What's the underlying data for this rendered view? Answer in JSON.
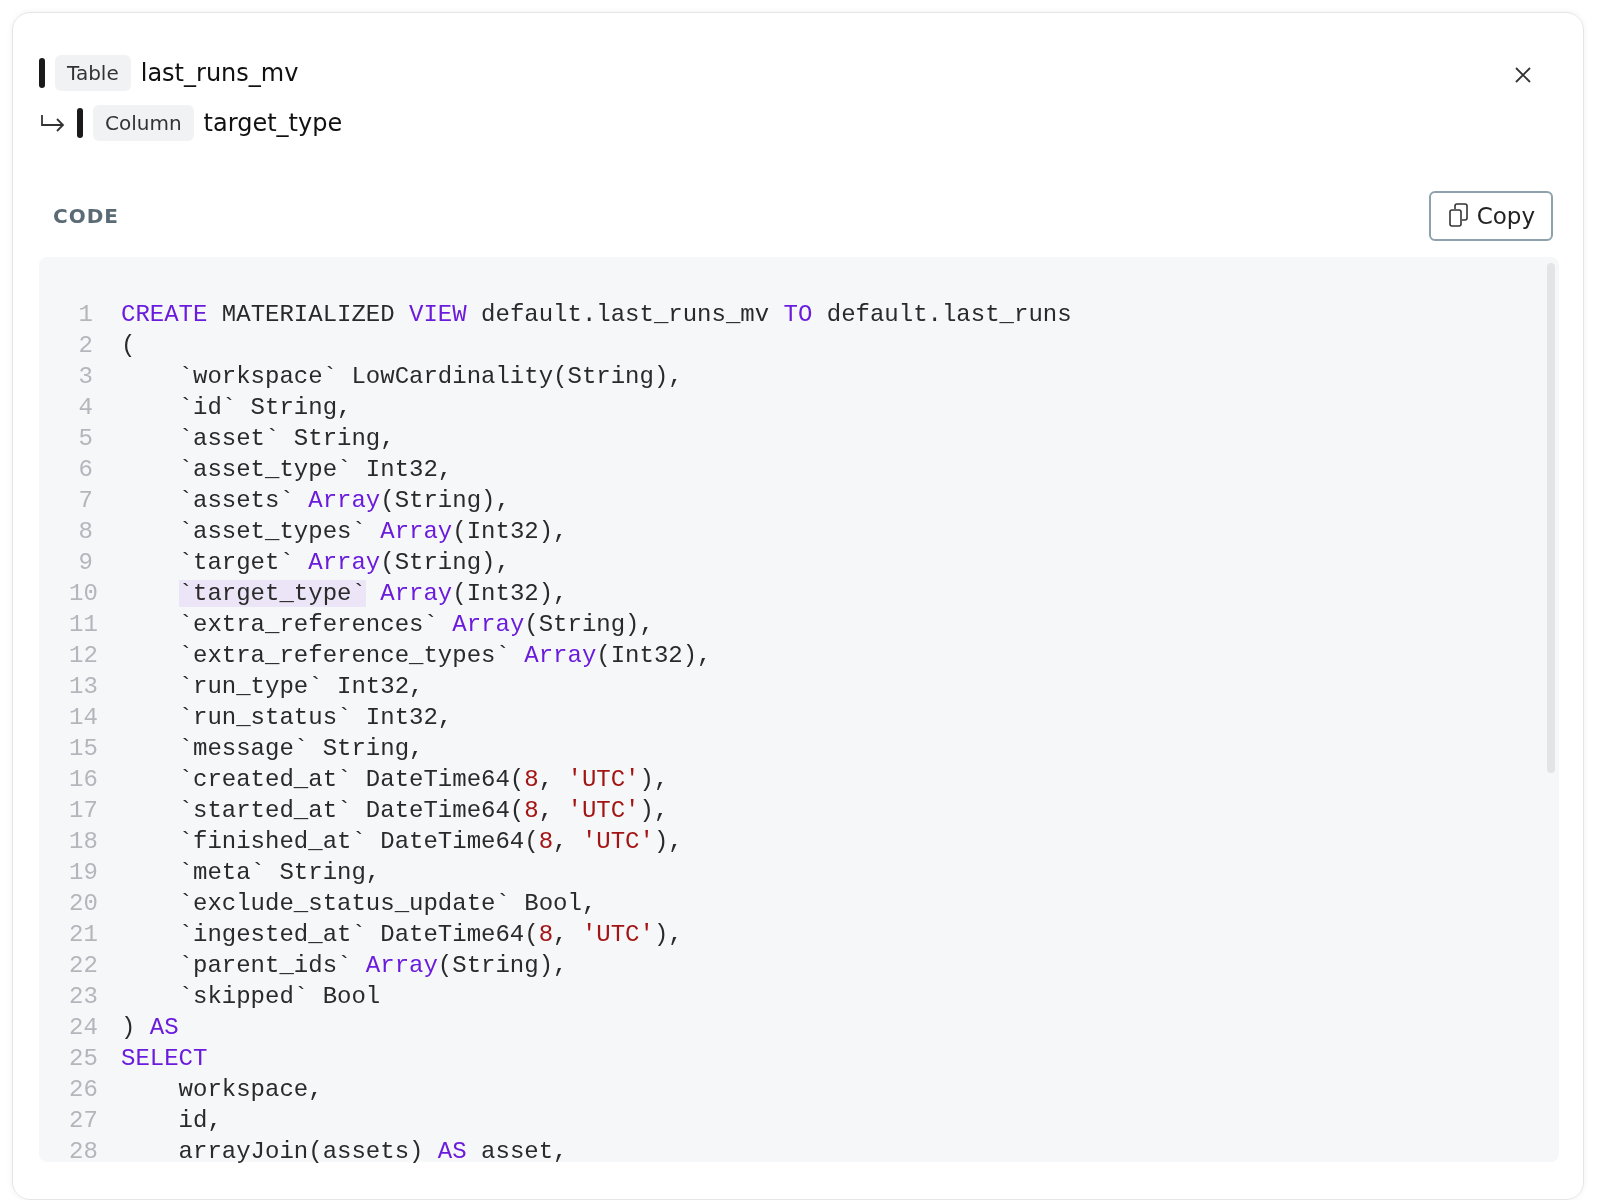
{
  "breadcrumbs": [
    {
      "kind": "root",
      "chip": "Table",
      "name": "last_runs_mv"
    },
    {
      "kind": "child",
      "chip": "Column",
      "name": "target_type"
    }
  ],
  "section_label": "CODE",
  "copy_button": {
    "label": "Copy"
  },
  "code": {
    "lines": [
      {
        "number": "1",
        "indented": false,
        "tokens": [
          {
            "kind": "keyword",
            "text": "CREATE"
          },
          {
            "kind": "plain",
            "text": " MATERIALIZED "
          },
          {
            "kind": "keyword",
            "text": "VIEW"
          },
          {
            "kind": "plain",
            "text": " default.last_runs_mv "
          },
          {
            "kind": "keyword",
            "text": "TO"
          },
          {
            "kind": "plain",
            "text": " default.last_runs"
          }
        ]
      },
      {
        "number": "2",
        "indented": false,
        "tokens": [
          {
            "kind": "plain",
            "text": "("
          }
        ]
      },
      {
        "number": "3",
        "indented": true,
        "tokens": [
          {
            "kind": "plain",
            "text": "`workspace` LowCardinality(String),"
          }
        ]
      },
      {
        "number": "4",
        "indented": true,
        "tokens": [
          {
            "kind": "plain",
            "text": "`id` String,"
          }
        ]
      },
      {
        "number": "5",
        "indented": true,
        "tokens": [
          {
            "kind": "plain",
            "text": "`asset` String,"
          }
        ]
      },
      {
        "number": "6",
        "indented": true,
        "tokens": [
          {
            "kind": "plain",
            "text": "`asset_type` Int32,"
          }
        ]
      },
      {
        "number": "7",
        "indented": true,
        "tokens": [
          {
            "kind": "plain",
            "text": "`assets` "
          },
          {
            "kind": "keyword",
            "text": "Array"
          },
          {
            "kind": "plain",
            "text": "(String),"
          }
        ]
      },
      {
        "number": "8",
        "indented": true,
        "tokens": [
          {
            "kind": "plain",
            "text": "`asset_types` "
          },
          {
            "kind": "keyword",
            "text": "Array"
          },
          {
            "kind": "plain",
            "text": "(Int32),"
          }
        ]
      },
      {
        "number": "9",
        "indented": true,
        "tokens": [
          {
            "kind": "plain",
            "text": "`target` "
          },
          {
            "kind": "keyword",
            "text": "Array"
          },
          {
            "kind": "plain",
            "text": "(String),"
          }
        ]
      },
      {
        "number": "10",
        "indented": true,
        "tokens": [
          {
            "kind": "match",
            "text": "`target_type`"
          },
          {
            "kind": "keyword",
            "text": " Array"
          },
          {
            "kind": "plain",
            "text": "(Int32),"
          }
        ]
      },
      {
        "number": "11",
        "indented": true,
        "tokens": [
          {
            "kind": "plain",
            "text": "`extra_references` "
          },
          {
            "kind": "keyword",
            "text": "Array"
          },
          {
            "kind": "plain",
            "text": "(String),"
          }
        ]
      },
      {
        "number": "12",
        "indented": true,
        "tokens": [
          {
            "kind": "plain",
            "text": "`extra_reference_types` "
          },
          {
            "kind": "keyword",
            "text": "Array"
          },
          {
            "kind": "plain",
            "text": "(Int32),"
          }
        ]
      },
      {
        "number": "13",
        "indented": true,
        "tokens": [
          {
            "kind": "plain",
            "text": "`run_type` Int32,"
          }
        ]
      },
      {
        "number": "14",
        "indented": true,
        "tokens": [
          {
            "kind": "plain",
            "text": "`run_status` Int32,"
          }
        ]
      },
      {
        "number": "15",
        "indented": true,
        "tokens": [
          {
            "kind": "plain",
            "text": "`message` String,"
          }
        ]
      },
      {
        "number": "16",
        "indented": true,
        "tokens": [
          {
            "kind": "plain",
            "text": "`created_at` DateTime64("
          },
          {
            "kind": "number",
            "text": "8"
          },
          {
            "kind": "plain",
            "text": ", "
          },
          {
            "kind": "string",
            "text": "'UTC'"
          },
          {
            "kind": "plain",
            "text": "),"
          }
        ]
      },
      {
        "number": "17",
        "indented": true,
        "tokens": [
          {
            "kind": "plain",
            "text": "`started_at` DateTime64("
          },
          {
            "kind": "number",
            "text": "8"
          },
          {
            "kind": "plain",
            "text": ", "
          },
          {
            "kind": "string",
            "text": "'UTC'"
          },
          {
            "kind": "plain",
            "text": "),"
          }
        ]
      },
      {
        "number": "18",
        "indented": true,
        "tokens": [
          {
            "kind": "plain",
            "text": "`finished_at` DateTime64("
          },
          {
            "kind": "number",
            "text": "8"
          },
          {
            "kind": "plain",
            "text": ", "
          },
          {
            "kind": "string",
            "text": "'UTC'"
          },
          {
            "kind": "plain",
            "text": "),"
          }
        ]
      },
      {
        "number": "19",
        "indented": true,
        "tokens": [
          {
            "kind": "plain",
            "text": "`meta` String,"
          }
        ]
      },
      {
        "number": "20",
        "indented": true,
        "tokens": [
          {
            "kind": "plain",
            "text": "`exclude_status_update` Bool,"
          }
        ]
      },
      {
        "number": "21",
        "indented": true,
        "tokens": [
          {
            "kind": "plain",
            "text": "`ingested_at` DateTime64("
          },
          {
            "kind": "number",
            "text": "8"
          },
          {
            "kind": "plain",
            "text": ", "
          },
          {
            "kind": "string",
            "text": "'UTC'"
          },
          {
            "kind": "plain",
            "text": "),"
          }
        ]
      },
      {
        "number": "22",
        "indented": true,
        "tokens": [
          {
            "kind": "plain",
            "text": "`parent_ids` "
          },
          {
            "kind": "keyword",
            "text": "Array"
          },
          {
            "kind": "plain",
            "text": "(String),"
          }
        ]
      },
      {
        "number": "23",
        "indented": true,
        "tokens": [
          {
            "kind": "plain",
            "text": "`skipped` Bool"
          }
        ]
      },
      {
        "number": "24",
        "indented": false,
        "tokens": [
          {
            "kind": "plain",
            "text": ") "
          },
          {
            "kind": "keyword",
            "text": "AS"
          }
        ]
      },
      {
        "number": "25",
        "indented": false,
        "tokens": [
          {
            "kind": "keyword",
            "text": "SELECT"
          }
        ]
      },
      {
        "number": "26",
        "indented": true,
        "tokens": [
          {
            "kind": "plain",
            "text": "workspace,"
          }
        ]
      },
      {
        "number": "27",
        "indented": true,
        "tokens": [
          {
            "kind": "plain",
            "text": "id,"
          }
        ]
      },
      {
        "number": "28",
        "indented": true,
        "tokens": [
          {
            "kind": "plain",
            "text": "arrayJoin(assets) "
          },
          {
            "kind": "keyword",
            "text": "AS"
          },
          {
            "kind": "plain",
            "text": " asset,"
          }
        ]
      }
    ]
  }
}
